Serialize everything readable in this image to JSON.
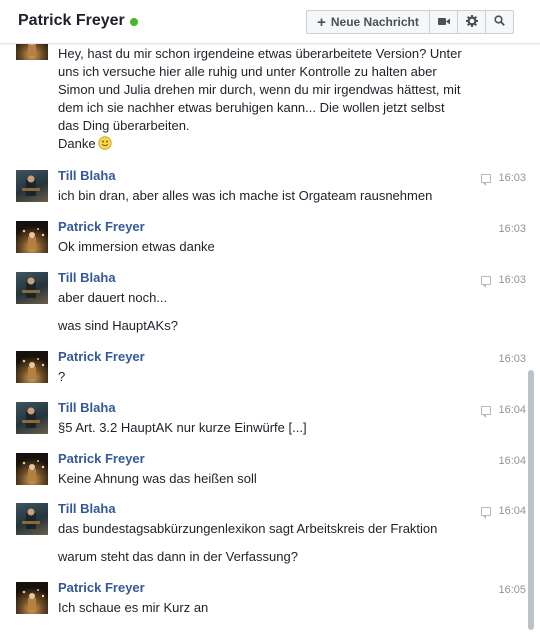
{
  "header": {
    "title": "Patrick Freyer",
    "new_message_label": "Neue Nachricht"
  },
  "messages": {
    "first_text_lines": [
      "Hey, hast du mir schon irgendeine etwas überarbeitete Version? Unter",
      "uns ich versuche hier alle ruhig und unter Kontrolle zu halten aber",
      "Simon und Julia drehen mir durch, wenn du mir irgendwas hättest, mit",
      "dem ich sie nachher etwas beruhigen kann... Die wollen jetzt selbst",
      "das Ding überarbeiten."
    ],
    "first_text_last": "Danke",
    "groups": [
      {
        "sender": "Till Blaha",
        "time": "16:03",
        "lines": [
          "ich bin dran, aber alles was ich mache ist Orgateam rausnehmen"
        ]
      },
      {
        "sender": "Patrick Freyer",
        "time": "16:03",
        "lines": [
          "Ok immersion etwas danke"
        ]
      },
      {
        "sender": "Till Blaha",
        "time": "16:03",
        "lines": [
          "aber dauert noch...",
          "was sind HauptAKs?"
        ]
      },
      {
        "sender": "Patrick Freyer",
        "time": "16:03",
        "lines": [
          "?"
        ]
      },
      {
        "sender": "Till Blaha",
        "time": "16:04",
        "lines": [
          "§5 Art. 3.2 HauptAK nur kurze Einwürfe [...]"
        ]
      },
      {
        "sender": "Patrick Freyer",
        "time": "16:04",
        "lines": [
          "Keine Ahnung was das heißen soll"
        ]
      },
      {
        "sender": "Till Blaha",
        "time": "16:04",
        "lines": [
          "das bundestagsabkürzungenlexikon sagt Arbeitskreis der Fraktion",
          "warum steht das dann in der Verfassung?"
        ]
      },
      {
        "sender": "Patrick Freyer",
        "time": "16:05",
        "lines": [
          "Ich schaue es mir Kurz an"
        ]
      }
    ]
  },
  "colors": {
    "sender_link": "#365899",
    "online": "#42b72a",
    "timestamp": "#90949c"
  },
  "icons": {
    "new_message": "plus-icon",
    "video": "video-camera-icon",
    "settings": "gear-icon",
    "search": "search-icon",
    "seen": "speech-bubble-icon",
    "emoji": "smiley-icon"
  }
}
